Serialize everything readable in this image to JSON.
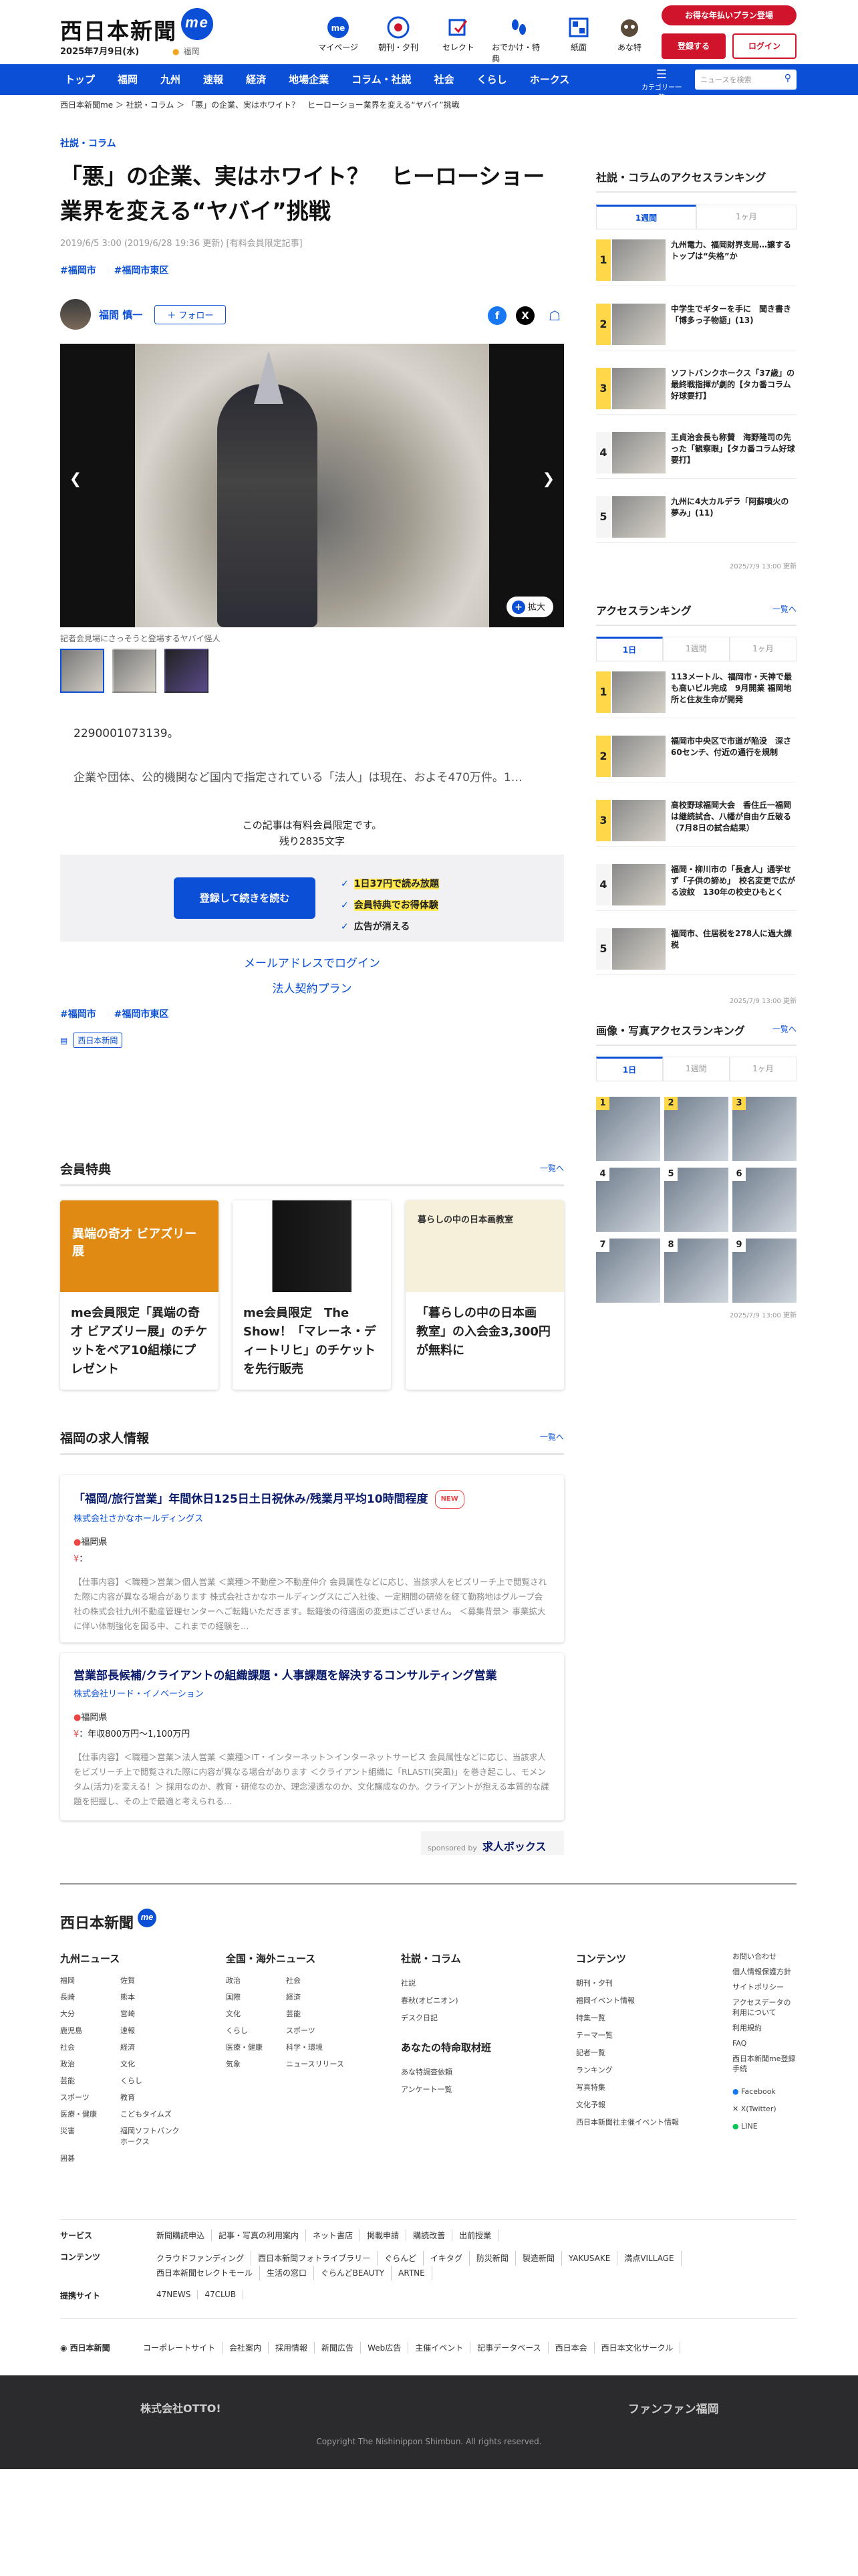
{
  "header": {
    "logo": "西日本新聞",
    "logo_badge": "me",
    "date": "2025年7月9日(水)",
    "location": "福岡",
    "nav": [
      {
        "label": "マイページ",
        "icon": "user-icon"
      },
      {
        "label": "朝刊・夕刊",
        "icon": "newspaper-icon"
      },
      {
        "label": "セレクト",
        "icon": "select-icon"
      },
      {
        "label": "おでかけ・特典",
        "icon": "footprint-icon"
      },
      {
        "label": "紙面",
        "icon": "grid-icon"
      },
      {
        "label": "あな特",
        "icon": "raccoon-icon"
      }
    ],
    "promo": "お得な年払いプラン登場",
    "register": "登録する",
    "login": "ログイン"
  },
  "navbar": {
    "items": [
      "トップ",
      "福岡",
      "九州",
      "速報",
      "経済",
      "地場企業",
      "コラム・社説",
      "社会",
      "くらし",
      "ホークス"
    ],
    "category_label": "カテゴリー一覧",
    "search_placeholder": "ニュースを検索"
  },
  "breadcrumb": "西日本新聞me ＞ 社説・コラム ＞ 「悪」の企業、実はホワイト？　ヒーローショー業界を変える“ヤバイ”挑戦",
  "article": {
    "category": "社説・コラム",
    "title": "「悪」の企業、実はホワイト？　ヒーローショー業界を変える“ヤバイ”挑戦",
    "meta": "2019/6/5 3:00 (2019/6/28 19:36 更新) [有料会員限定記事]",
    "tags": [
      "#福岡市",
      "#福岡市東区"
    ],
    "author": "福間 慎一",
    "follow": "＋ フォロー",
    "zoom": "拡大",
    "caption": "記者会見場にさっそうと登場するヤバイ怪人",
    "lead_number": "2290001073139。",
    "lead_text": "企業や団体、公的機関など国内で指定されている「法人」は現在、およそ470万件。1…",
    "paywall_note": "この記事は有料会員限定です。",
    "remaining": "残り2835文字",
    "register_button": "登録して続きを読む",
    "perks": [
      "1日37円で読み放題",
      "会員特典でお得体験",
      "広告が消える"
    ],
    "email_login": "メールアドレスでログイン",
    "corp_plan": "法人契約プラン",
    "bottom_tags": [
      "#福岡市",
      "#福岡市東区"
    ],
    "source_badge": "西日本新聞"
  },
  "benefits": {
    "heading": "会員特典",
    "more": "一覧へ",
    "cards": [
      {
        "title": "me会員限定「異端の奇才 ビアズリー展」のチケットをペア10組様にプレゼント",
        "img_text": "異端の奇才 ビアズリー展"
      },
      {
        "title": "me会員限定　The Show！「マレーネ・ディートリヒ」のチケットを先行販売",
        "img_text": ""
      },
      {
        "title": "「暮らしの中の日本画　教室」の入会金3,300円が無料に",
        "img_text": "暮らしの中の日本画教室"
      }
    ]
  },
  "jobs": {
    "heading": "福岡の求人情報",
    "more": "一覧へ",
    "items": [
      {
        "title": "「福岡/旅行営業」年間休日125日土日祝休み/残業月平均10時間程度",
        "new": "NEW",
        "company": "株式会社さかなホールディングス",
        "place": "福岡県",
        "salary": "：",
        "desc": "【仕事内容】＜職種＞営業＞個人営業 ＜業種＞不動産＞不動産仲介 会員属性などに応じ、当該求人をビズリーチ上で閲覧された際に内容が異なる場合があります 株式会社さかなホールディングスにご入社後、一定期間の研修を経て勤務地はグループ会社の株式会社九州不動産管理センターへご転籍いただきます。転籍後の待遇面の変更はございません。 ＜募集背景＞ 事業拡大に伴い体制強化を図る中、これまでの経験を…"
      },
      {
        "title": "営業部長候補/クライアントの組織課題・人事課題を解決するコンサルティング営業",
        "new": "",
        "company": "株式会社リード・イノベーション",
        "place": "福岡県",
        "salary": "：年収800万円～1,100万円",
        "desc": "【仕事内容】＜職種＞営業＞法人営業 ＜業種＞IT・インターネット＞インターネットサービス 会員属性などに応じ、当該求人をビズリーチ上で閲覧された際に内容が異なる場合があります ＜クライアント組織に「RLASTI(突風)」を巻き起こし、モメンタム(活力)を変える！＞ 採用なのか、教育・研修なのか、理念浸透なのか、文化醸成なのか。クライアントが抱える本質的な課題を把握し、その上で最適と考えられる…"
      }
    ],
    "sponsor_label": "sponsored by",
    "sponsor_name": "求人ボックス"
  },
  "sidebar": {
    "column_ranking": {
      "heading": "社説・コラムのアクセスランキング",
      "tabs": [
        "1週間",
        "1ヶ月"
      ],
      "items": [
        "九州電力、福岡財界支局…譲するトップは“失格”か",
        "中学生でギターを手に　聞き書き「博多っ子物語」(13)",
        "ソフトバンクホークス「37歳」の最終戦指揮が劇的【タカ番コラム好球要打】",
        "王貞治会長も称賛　海野隆司の先った「観察眼」【タカ番コラム好球要打】",
        "九州に4大カルデラ「阿蘇噴火の夢み」(11)"
      ],
      "updated": "2025/7/9 13:00 更新"
    },
    "access_ranking": {
      "heading": "アクセスランキング",
      "more": "一覧へ",
      "tabs": [
        "1日",
        "1週間",
        "1ヶ月"
      ],
      "items": [
        "113メートル、福岡市・天神で最も高いビル完成　9月開業 福岡地所と住友生命が開発",
        "福岡市中央区で市道が陥没　深さ60センチ、付近の通行を規制",
        "高校野球福岡大会　香住丘一福岡は継続試合、八幡が自由ケ丘破る（7月8日の試合結果）",
        "福岡・柳川市の「長倉人」通学せず「子供の諦め」　校名変更で広がる波紋　130年の校史ひもとく",
        "福岡市、住居税を278人に過大課税"
      ],
      "updated": "2025/7/9 13:00 更新"
    },
    "photo_ranking": {
      "heading": "画像・写真アクセスランキング",
      "more": "一覧へ",
      "tabs": [
        "1日",
        "1週間",
        "1ヶ月"
      ],
      "numbers": [
        "1",
        "2",
        "3",
        "4",
        "5",
        "6",
        "7",
        "8",
        "9"
      ],
      "updated": "2025/7/9 13:00 更新"
    }
  },
  "footer": {
    "logo": "西日本新聞",
    "kyushu": {
      "heading": "九州ニュース",
      "items": [
        "福岡",
        "佐賀",
        "長崎",
        "熊本",
        "大分",
        "宮崎",
        "鹿児島",
        "速報",
        "社会",
        "経済",
        "政治",
        "文化",
        "芸能",
        "くらし",
        "スポーツ",
        "教育",
        "医療・健康",
        "こどもタイムズ",
        "災害",
        "福岡ソフトバンクホークス",
        "囲碁",
        ""
      ]
    },
    "national": {
      "heading": "全国・海外ニュース",
      "items": [
        "政治",
        "社会",
        "国際",
        "経済",
        "文化",
        "芸能",
        "くらし",
        "スポーツ",
        "医療・健康",
        "科学・環境",
        "気象",
        "ニュースリリース"
      ]
    },
    "column": {
      "heading": "社説・コラム",
      "items": [
        "社説",
        "春秋(オピニオン)",
        "デスク日記"
      ]
    },
    "request": {
      "heading": "あなたの特命取材班",
      "items": [
        "あな特調査依頼",
        "アンケート一覧"
      ]
    },
    "contents": {
      "heading": "コンテンツ",
      "items": [
        "朝刊・夕刊",
        "福岡イベント情報",
        "特集一覧",
        "テーマ一覧",
        "記者一覧",
        "ランキング",
        "写真特集",
        "文化予報",
        "西日本新聞社主催イベント情報"
      ]
    },
    "misc": [
      "お問い合わせ",
      "個人情報保護方針",
      "サイトポリシー",
      "アクセスデータの利用について",
      "利用規約",
      "FAQ",
      "西日本新聞me登録手続"
    ],
    "social": [
      "Facebook",
      "X(Twitter)",
      "LINE"
    ],
    "services_label": "サービス",
    "services": [
      "新聞購読申込",
      "記事・写真の利用案内",
      "ネット書店",
      "掲載申請",
      "購読改善",
      "出前授業"
    ],
    "contents_label": "コンテンツ",
    "contents_row": [
      "クラウドファンディング",
      "西日本新聞フォトライブラリー",
      "ぐらんど",
      "イキタグ",
      "防災新聞",
      "製造新聞",
      "YAKUSAKE",
      "満点VILLAGE",
      "西日本新聞セレクトモール",
      "生活の窓口",
      "ぐらんどBEAUTY",
      "ARTNE"
    ],
    "partner_label": "提携サイト",
    "partners": [
      "47NEWS",
      "47CLUB"
    ],
    "corp_logo": "西日本新聞",
    "corp_links": [
      "コーポレートサイト",
      "会社案内",
      "採用情報",
      "新聞広告",
      "Web広告",
      "主催イベント",
      "記事データベース",
      "西日本会",
      "西日本文化サークル"
    ],
    "bottom_left": "株式会社OTTO!",
    "bottom_right": "ファンファン福岡",
    "copyright": "Copyright The Nishinippon Shimbun. All rights reserved."
  }
}
